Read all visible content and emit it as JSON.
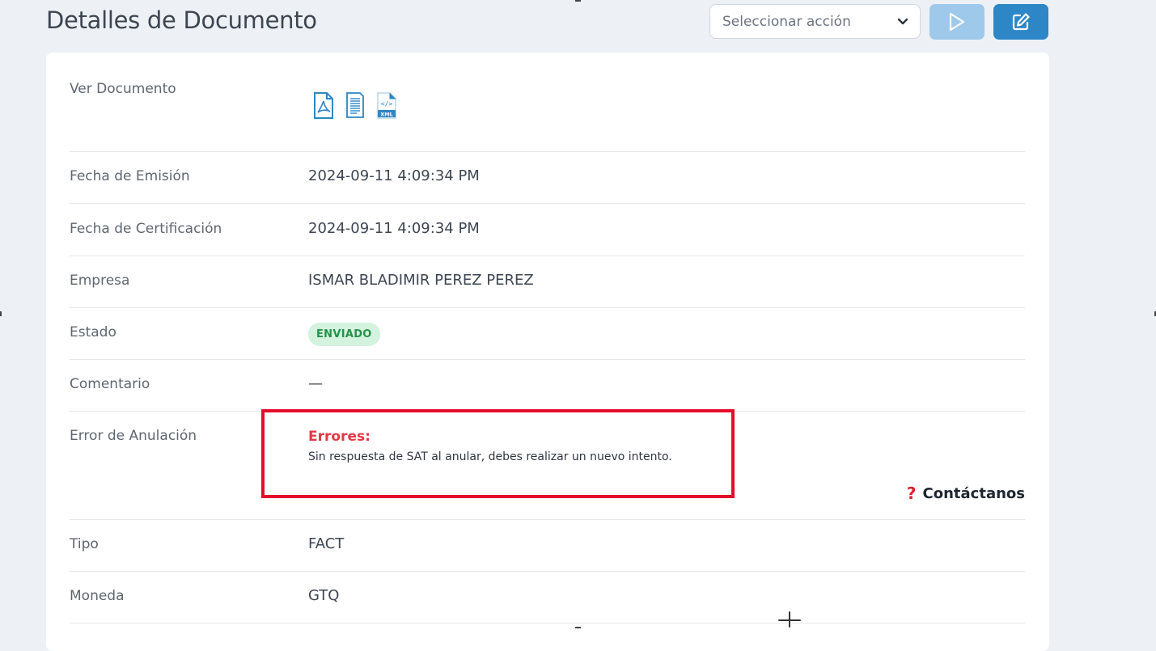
{
  "header": {
    "title": "Detalles de Documento",
    "action_select_placeholder": "Seleccionar acción"
  },
  "details": {
    "ver_documento": {
      "label": "Ver Documento",
      "icons": [
        "pdf-icon",
        "document-icon",
        "xml-icon"
      ]
    },
    "fecha_emision": {
      "label": "Fecha de Emisión",
      "value": "2024-09-11 4:09:34 PM"
    },
    "fecha_certificacion": {
      "label": "Fecha de Certificación",
      "value": "2024-09-11 4:09:34 PM"
    },
    "empresa": {
      "label": "Empresa",
      "value": "ISMAR BLADIMIR PEREZ PEREZ"
    },
    "estado": {
      "label": "Estado",
      "value": "ENVIADO"
    },
    "comentario": {
      "label": "Comentario",
      "value": "—"
    },
    "error_anulacion": {
      "label": "Error de Anulación",
      "title": "Errores:",
      "message": "Sin respuesta de SAT al anular, debes realizar un nuevo intento.",
      "contact_label": "Contáctanos"
    },
    "tipo": {
      "label": "Tipo",
      "value": "FACT"
    },
    "moneda": {
      "label": "Moneda",
      "value": "GTQ"
    }
  },
  "colors": {
    "primary": "#2d86c6",
    "primary_disabled": "#9fc9ea",
    "status_badge_bg": "#d4f3df",
    "status_badge_text": "#279149",
    "error": "#e63845",
    "highlight_border": "#e50d2b"
  }
}
